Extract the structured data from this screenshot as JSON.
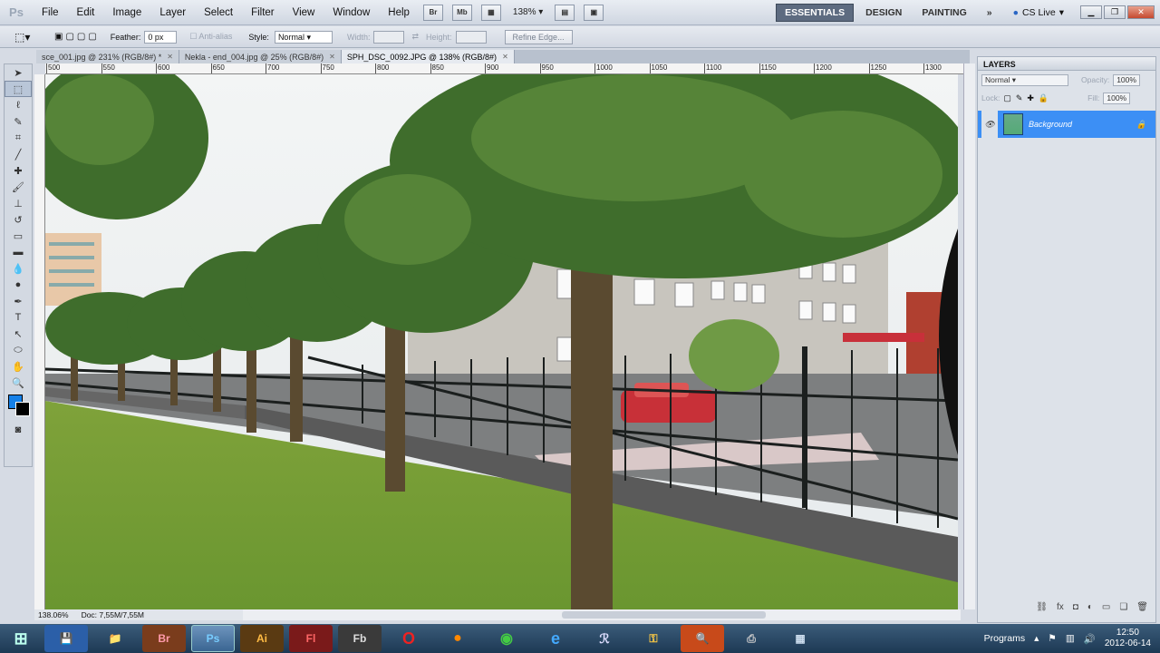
{
  "app": {
    "logo": "Ps"
  },
  "menu": [
    "File",
    "Edit",
    "Image",
    "Layer",
    "Select",
    "Filter",
    "View",
    "Window",
    "Help"
  ],
  "menubar": {
    "btn_br": "Br",
    "btn_mb": "Mb",
    "zoom": "138%",
    "workspaces": [
      "ESSENTIALS",
      "DESIGN",
      "PAINTING"
    ],
    "more": "»",
    "cslive": "CS Live"
  },
  "options": {
    "feather_label": "Feather:",
    "feather_value": "0 px",
    "antialias": "Anti-alias",
    "style_label": "Style:",
    "style_value": "Normal",
    "width_label": "Width:",
    "height_label": "Height:",
    "refine": "Refine Edge..."
  },
  "tabs": [
    {
      "label": "sce_001.jpg @ 231% (RGB/8#) *"
    },
    {
      "label": "Nekla - end_004.jpg @ 25% (RGB/8#)"
    },
    {
      "label": "SPH_DSC_0092.JPG @ 138% (RGB/8#)"
    }
  ],
  "ruler": [
    "500",
    "550",
    "600",
    "650",
    "700",
    "750",
    "800",
    "850",
    "900",
    "950",
    "1000",
    "1050",
    "1100",
    "1150",
    "1200",
    "1250",
    "1300"
  ],
  "status": {
    "zoom": "138.06%",
    "doc": "Doc: 7,55M/7,55M"
  },
  "layers": {
    "title": "LAYERS",
    "blend": "Normal",
    "opacity_label": "Opacity:",
    "opacity": "100%",
    "lock_label": "Lock:",
    "fill_label": "Fill:",
    "fill": "100%",
    "layer_name": "Background"
  },
  "taskbar": {
    "apps": [
      "Br",
      "Ps",
      "Ai",
      "Fl",
      "Fb"
    ],
    "programs": "Programs",
    "time": "12:50",
    "date": "2012-06-14"
  }
}
